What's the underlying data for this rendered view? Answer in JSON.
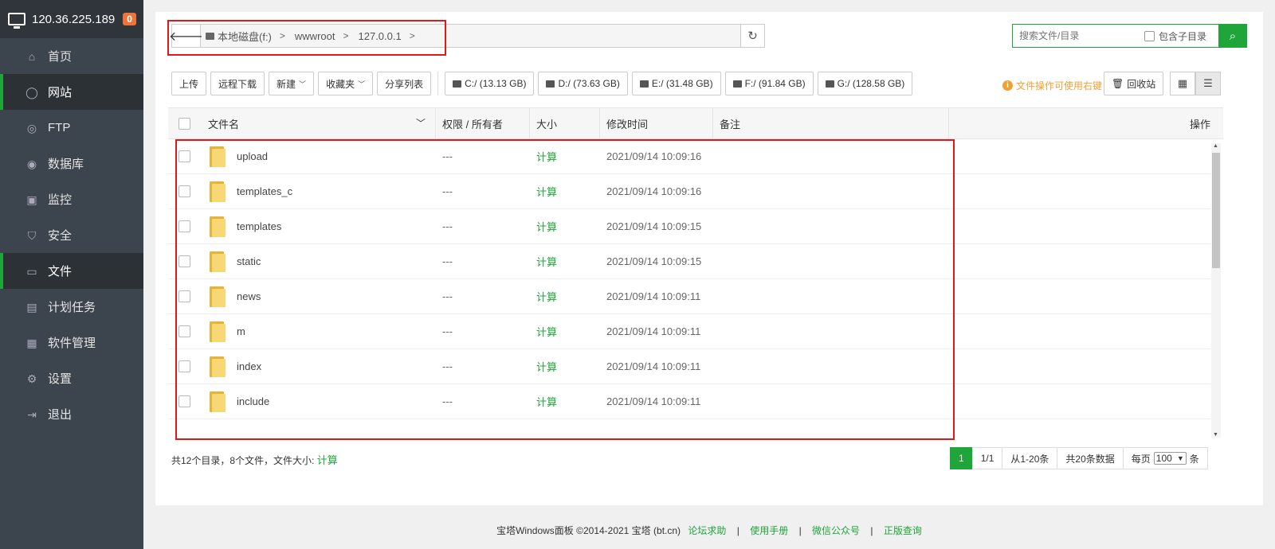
{
  "server": {
    "ip": "120.36.225.189",
    "badge": "0"
  },
  "sidebar": {
    "items": [
      {
        "label": "首页",
        "icon": "home-icon",
        "glyph": "⌂",
        "active": false
      },
      {
        "label": "网站",
        "icon": "globe-icon",
        "glyph": "◯",
        "active": true
      },
      {
        "label": "FTP",
        "icon": "ftp-icon",
        "glyph": "◎",
        "active": false
      },
      {
        "label": "数据库",
        "icon": "database-icon",
        "glyph": "◉",
        "active": false
      },
      {
        "label": "监控",
        "icon": "monitor-icon",
        "glyph": "▣",
        "active": false
      },
      {
        "label": "安全",
        "icon": "shield-icon",
        "glyph": "⛉",
        "active": false
      },
      {
        "label": "文件",
        "icon": "folder-icon",
        "glyph": "▭",
        "active": true
      },
      {
        "label": "计划任务",
        "icon": "calendar-icon",
        "glyph": "▤",
        "active": false
      },
      {
        "label": "软件管理",
        "icon": "apps-icon",
        "glyph": "▦",
        "active": false
      },
      {
        "label": "设置",
        "icon": "gear-icon",
        "glyph": "⚙",
        "active": false
      },
      {
        "label": "退出",
        "icon": "logout-icon",
        "glyph": "⇥",
        "active": false
      }
    ]
  },
  "path": {
    "crumbs": [
      "本地磁盘(f:)",
      "wwwroot",
      "127.0.0.1"
    ]
  },
  "search": {
    "placeholder": "搜索文件/目录",
    "include_sub_label": "包含子目录"
  },
  "toolbar": {
    "upload": "上传",
    "remote_download": "远程下载",
    "new": "新建",
    "favorites": "收藏夹",
    "share_list": "分享列表",
    "disks": [
      "C:/ (13.13 GB)",
      "D:/ (73.63 GB)",
      "E:/ (31.48 GB)",
      "F:/ (91.84 GB)",
      "G:/ (128.58 GB)"
    ],
    "tip": "文件操作可使用右键",
    "recycle": "回收站"
  },
  "table": {
    "headers": {
      "name": "文件名",
      "perm": "权限 / 所有者",
      "size": "大小",
      "mtime": "修改时间",
      "note": "备注",
      "ops": "操作"
    },
    "rows": [
      {
        "name": "upload",
        "perm": "---",
        "size": "计算",
        "mtime": "2021/09/14 10:09:16"
      },
      {
        "name": "templates_c",
        "perm": "---",
        "size": "计算",
        "mtime": "2021/09/14 10:09:16"
      },
      {
        "name": "templates",
        "perm": "---",
        "size": "计算",
        "mtime": "2021/09/14 10:09:15"
      },
      {
        "name": "static",
        "perm": "---",
        "size": "计算",
        "mtime": "2021/09/14 10:09:15"
      },
      {
        "name": "news",
        "perm": "---",
        "size": "计算",
        "mtime": "2021/09/14 10:09:11"
      },
      {
        "name": "m",
        "perm": "---",
        "size": "计算",
        "mtime": "2021/09/14 10:09:11"
      },
      {
        "name": "index",
        "perm": "---",
        "size": "计算",
        "mtime": "2021/09/14 10:09:11"
      },
      {
        "name": "include",
        "perm": "---",
        "size": "计算",
        "mtime": "2021/09/14 10:09:11"
      }
    ]
  },
  "summary": {
    "text": "共12个目录，8个文件，文件大小: ",
    "calc": "计算"
  },
  "pager": {
    "current": "1",
    "pages": "1/1",
    "range": "从1-20条",
    "total": "共20条数据",
    "per_page_label": "每页",
    "per_page_value": "100",
    "per_page_unit": "条"
  },
  "footer": {
    "copyright": "宝塔Windows面板 ©2014-2021 宝塔 (bt.cn)",
    "links": [
      "论坛求助",
      "使用手册",
      "微信公众号",
      "正版查询"
    ]
  },
  "colors": {
    "accent": "#20a53a",
    "sidebar": "#3c444d",
    "warning": "#f0a136",
    "highlight": "#e01818"
  }
}
